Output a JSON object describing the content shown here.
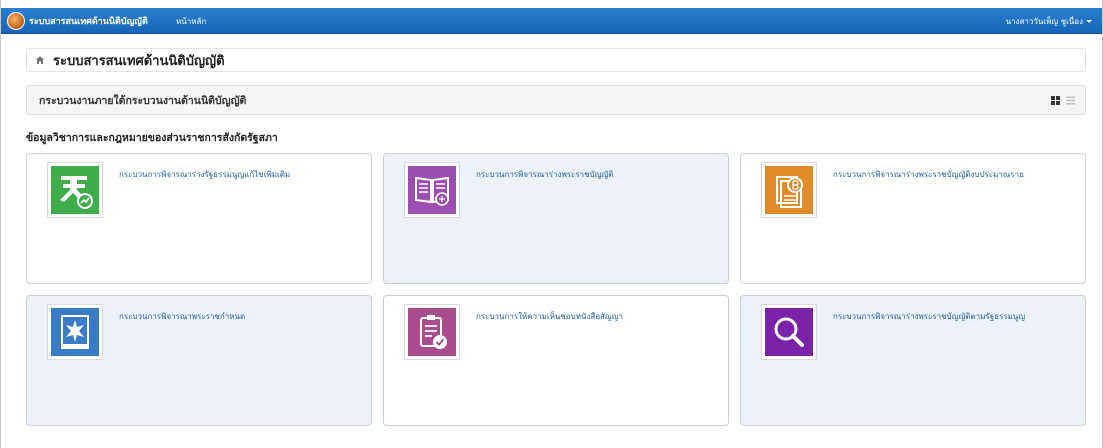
{
  "navbar": {
    "brand": "ระบบสารสนเทศด้านนิติบัญญัติ",
    "home": "หน้าหลัก",
    "user": "นางสาววันเพ็ญ ชูเนื่อง"
  },
  "breadcrumb": {
    "title": "ระบบสารสนเทศด้านนิติบัญญัติ"
  },
  "section": {
    "title": "กระบวนงานภายใต้กระบวนงานด้านนิติบัญญัติ"
  },
  "group": {
    "heading": "ข้อมูลวิชาการและกฎหมายของส่วนราชการสังกัดรัฐสภา"
  },
  "cards": [
    {
      "label": "กระบวนการพิจารณาร่างรัฐธรรมนูญแก้ไขเพิ่มเติม",
      "icon": "constitution-icon",
      "color": "#3fae4a"
    },
    {
      "label": "กระบวนการพิจารณาร่างพระราชบัญญัติ",
      "icon": "law-book-icon",
      "color": "#9b4fb0"
    },
    {
      "label": "กระบวนการพิจารณาร่างพระราชบัญญัติงบประมาณราย",
      "icon": "budget-document-icon",
      "color": "#e08a2a"
    },
    {
      "label": "กระบวนการพิจารณาพระราชกำหนด",
      "icon": "decree-icon",
      "color": "#3a7bc8"
    },
    {
      "label": "กระบวนการให้ความเห็นชอบหนังสือสัญญา",
      "icon": "treaty-approval-icon",
      "color": "#a94d8e"
    },
    {
      "label": "กระบวนการพิจารณาร่างพระราชบัญญัติตามรัฐธรรมนูญ",
      "icon": "search-magnifier-icon",
      "color": "#7a22a8"
    }
  ]
}
